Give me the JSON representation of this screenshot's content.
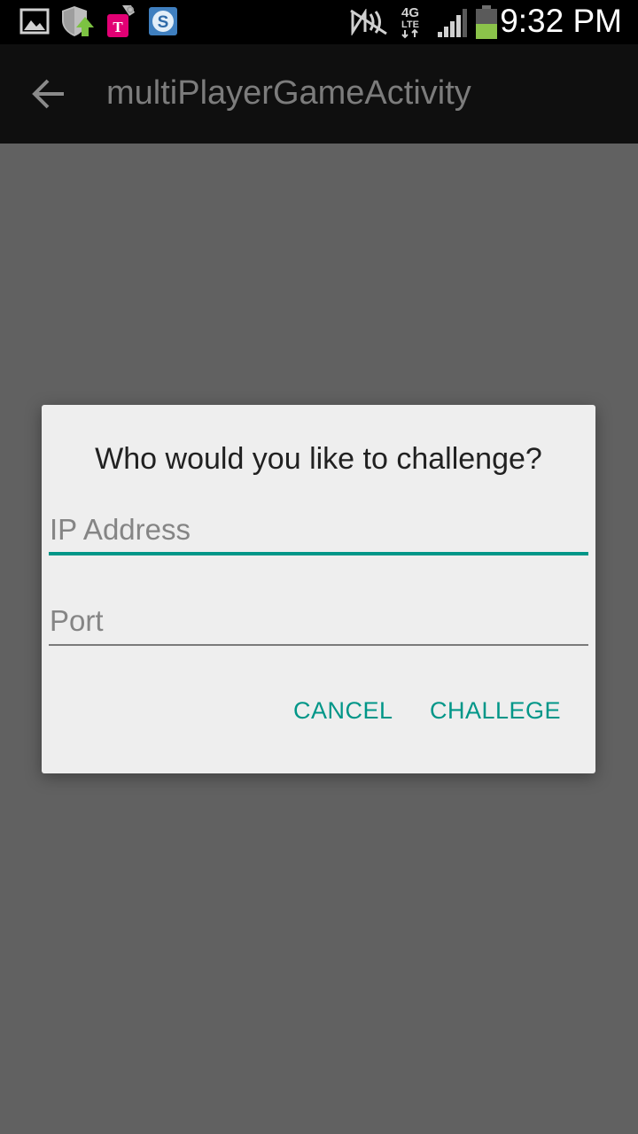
{
  "status_bar": {
    "time": "9:32 PM",
    "icons": [
      "image-icon",
      "shield-update-icon",
      "tmobile-icon",
      "s-app-icon",
      "nfc-icon",
      "4g-lte-icon",
      "signal-icon",
      "battery-icon"
    ],
    "battery_color": "#8bc34a"
  },
  "action_bar": {
    "title": "multiPlayerGameActivity",
    "back_icon": "arrow-back-icon"
  },
  "dialog": {
    "title": "Who would you like to challenge?",
    "ip_placeholder": "IP Address",
    "port_placeholder": "Port",
    "cancel_label": "CANCEL",
    "challenge_label": "CHALLEGE",
    "accent_color": "#009688"
  }
}
